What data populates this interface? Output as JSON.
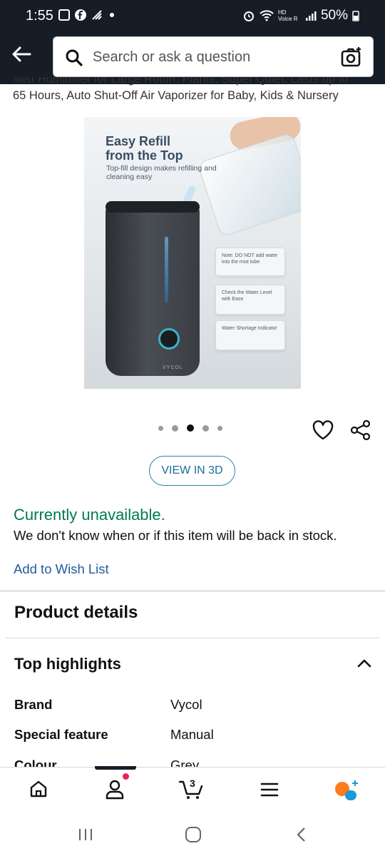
{
  "status_bar": {
    "time": "1:55",
    "battery": "50%",
    "network": "HD Voice R"
  },
  "search": {
    "placeholder": "Search or ask a question"
  },
  "product": {
    "title_line1": "Mist Humidifier for Large Room, Plants, Super Quiet, Lasts up to",
    "title_line2": "65 Hours, Auto Shut-Off Air Vaporizer for Baby, Kids & Nursery",
    "image": {
      "headline": "Easy Refill\nfrom the Top",
      "subhead": "Top-fill design makes refilling and cleaning easy",
      "notes": [
        "Note: DO NOT add water into the mist tube",
        "Check the Water Level with Ease",
        "Water Shortage Indicator"
      ],
      "brand_mark": "VYCOL"
    },
    "carousel": {
      "count": 5,
      "active_index": 2
    },
    "view_3d_label": "VIEW IN 3D",
    "availability": "Currently unavailable.",
    "stock_message": "We don't know when or if this item will be back in stock.",
    "wishlist_label": "Add to Wish List"
  },
  "details": {
    "section_title": "Product details",
    "highlights_title": "Top highlights",
    "rows": [
      {
        "key": "Brand",
        "value": "Vycol"
      },
      {
        "key": "Special feature",
        "value": "Manual"
      },
      {
        "key": "Colour",
        "value": "Grey"
      }
    ]
  },
  "bottom_nav": {
    "items": [
      "home-icon",
      "account-icon",
      "cart-icon",
      "menu-icon",
      "rufus-icon"
    ],
    "cart_count": "3",
    "accent": "#ff9900"
  },
  "colors": {
    "header_bg": "#161d26",
    "available_green": "#007a55",
    "link_blue": "#1e5d9b"
  }
}
